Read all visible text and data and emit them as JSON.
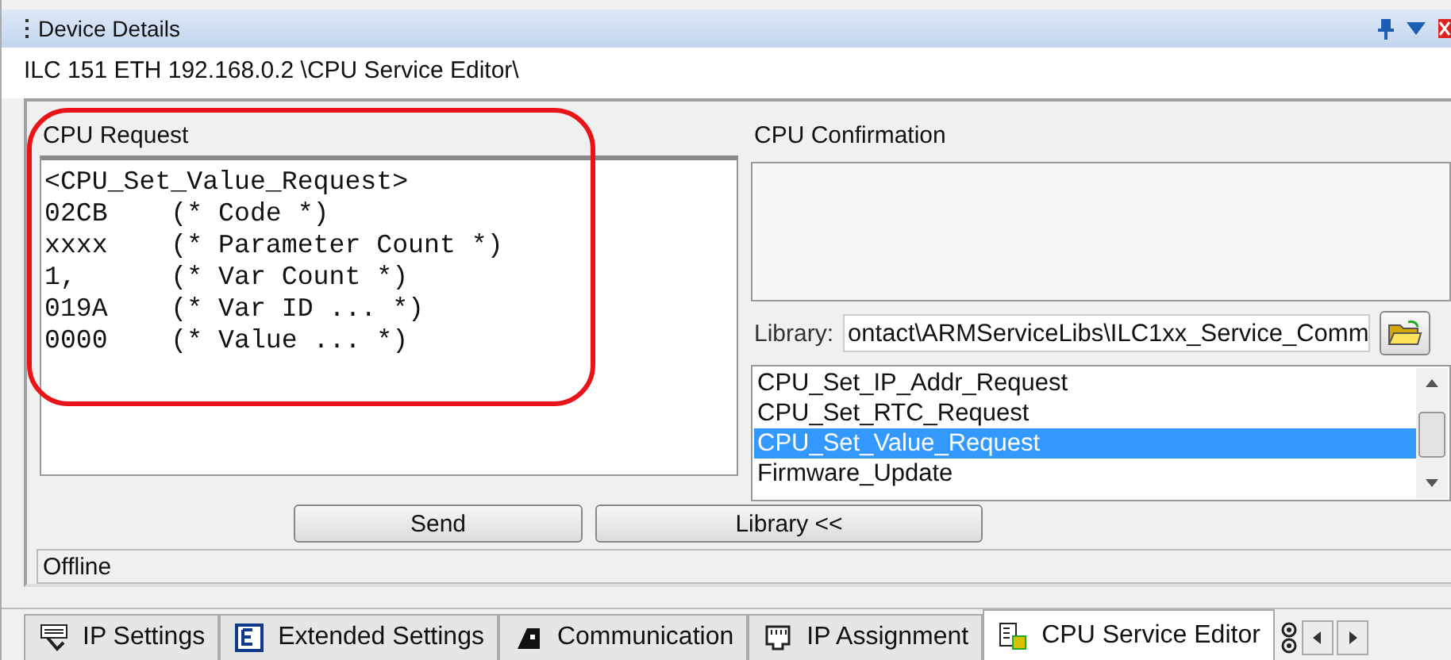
{
  "window": {
    "title": "Device Details"
  },
  "breadcrumb": "ILC 151 ETH 192.168.0.2 \\CPU Service Editor\\",
  "request": {
    "label": "CPU Request",
    "lines": [
      "<CPU_Set_Value_Request>",
      "02CB    (* Code *)",
      "xxxx    (* Parameter Count *)",
      "1,      (* Var Count *)",
      "019A    (* Var ID ... *)",
      "0000    (* Value ... *)"
    ]
  },
  "confirmation": {
    "label": "CPU Confirmation"
  },
  "library": {
    "label": "Library:",
    "value": "ontact\\ARMServiceLibs\\ILC1xx_Service_Comm",
    "items": [
      {
        "label": "CPU_Set_IP_Addr_Request",
        "selected": false
      },
      {
        "label": "CPU_Set_RTC_Request",
        "selected": false
      },
      {
        "label": "CPU_Set_Value_Request",
        "selected": true
      },
      {
        "label": "Firmware_Update",
        "selected": false
      }
    ]
  },
  "buttons": [
    "Send",
    "Library <<"
  ],
  "status_bar": "Offline",
  "tabs": [
    {
      "label": "IP Settings",
      "selected": false
    },
    {
      "label": "Extended Settings",
      "selected": false
    },
    {
      "label": "Communication",
      "selected": false
    },
    {
      "label": "IP Assignment",
      "selected": false
    },
    {
      "label": "CPU Service Editor",
      "selected": true
    }
  ]
}
